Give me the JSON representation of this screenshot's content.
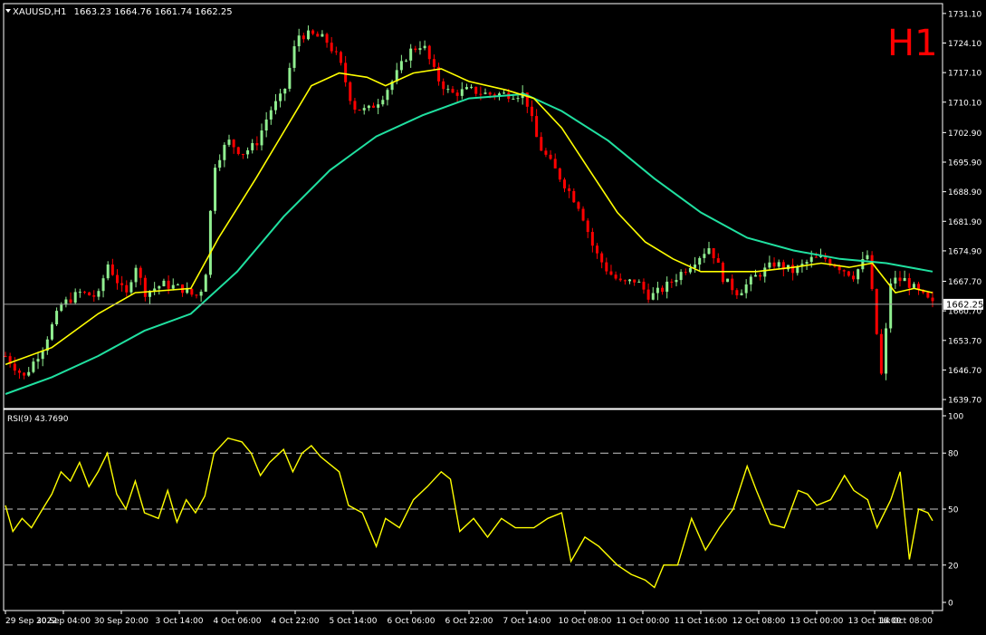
{
  "header": {
    "symbol_label": "XAUUSD,H1",
    "ohlc": "1663.23 1664.76 1661.74 1662.25",
    "timeframe_badge": "H1",
    "rsi_label": "RSI(9) 43.7690"
  },
  "colors": {
    "background": "#000000",
    "axis": "#ffffff",
    "bull_candle": "#90ee90",
    "bear_candle": "#ff0000",
    "ma_fast": "#ffff00",
    "ma_slow": "#20e0a0",
    "rsi_line": "#ffff00",
    "badge": "#ff0000"
  },
  "chart_data": [
    {
      "type": "candlestick",
      "symbol": "XAUUSD",
      "timeframe": "H1",
      "current_price": 1662.25,
      "current_price_label": "1662.25",
      "ylim": [
        1638.0,
        1733.0
      ],
      "y_ticks": [
        {
          "value": 1731.1,
          "label": "1731.10"
        },
        {
          "value": 1724.1,
          "label": "1724.10"
        },
        {
          "value": 1717.1,
          "label": "1717.10"
        },
        {
          "value": 1710.1,
          "label": "1710.10"
        },
        {
          "value": 1702.9,
          "label": "1702.90"
        },
        {
          "value": 1695.9,
          "label": "1695.90"
        },
        {
          "value": 1688.9,
          "label": "1688.90"
        },
        {
          "value": 1681.9,
          "label": "1681.90"
        },
        {
          "value": 1674.9,
          "label": "1674.90"
        },
        {
          "value": 1667.7,
          "label": "1667.70"
        },
        {
          "value": 1660.7,
          "label": "1660.70"
        },
        {
          "value": 1653.7,
          "label": "1653.70"
        },
        {
          "value": 1646.7,
          "label": "1646.70"
        },
        {
          "value": 1639.7,
          "label": "1639.70"
        }
      ],
      "x_ticks": [
        {
          "label": "29 Sep 2022",
          "frac": 0.0
        },
        {
          "label": "30 Sep 04:00",
          "frac": 0.0625
        },
        {
          "label": "30 Sep 20:00",
          "frac": 0.125
        },
        {
          "label": "3 Oct 14:00",
          "frac": 0.1875
        },
        {
          "label": "4 Oct 06:00",
          "frac": 0.25
        },
        {
          "label": "4 Oct 22:00",
          "frac": 0.3125
        },
        {
          "label": "5 Oct 14:00",
          "frac": 0.375
        },
        {
          "label": "6 Oct 06:00",
          "frac": 0.4375
        },
        {
          "label": "6 Oct 22:00",
          "frac": 0.5
        },
        {
          "label": "7 Oct 14:00",
          "frac": 0.5625
        },
        {
          "label": "10 Oct 08:00",
          "frac": 0.625
        },
        {
          "label": "11 Oct 00:00",
          "frac": 0.6875
        },
        {
          "label": "11 Oct 16:00",
          "frac": 0.75
        },
        {
          "label": "12 Oct 08:00",
          "frac": 0.8125
        },
        {
          "label": "13 Oct 00:00",
          "frac": 0.875
        },
        {
          "label": "13 Oct 16:00",
          "frac": 0.9375
        },
        {
          "label": "14 Oct 08:00",
          "frac": 1.0
        }
      ],
      "close_path": [
        [
          0.0,
          1650
        ],
        [
          0.02,
          1645
        ],
        [
          0.04,
          1652
        ],
        [
          0.06,
          1662
        ],
        [
          0.08,
          1665
        ],
        [
          0.1,
          1664
        ],
        [
          0.11,
          1672
        ],
        [
          0.12,
          1668
        ],
        [
          0.13,
          1664
        ],
        [
          0.14,
          1672
        ],
        [
          0.15,
          1665
        ],
        [
          0.17,
          1667
        ],
        [
          0.19,
          1666
        ],
        [
          0.205,
          1664
        ],
        [
          0.215,
          1667
        ],
        [
          0.225,
          1695
        ],
        [
          0.24,
          1701
        ],
        [
          0.255,
          1698
        ],
        [
          0.27,
          1700
        ],
        [
          0.285,
          1708
        ],
        [
          0.3,
          1712
        ],
        [
          0.315,
          1726
        ],
        [
          0.33,
          1726
        ],
        [
          0.345,
          1725
        ],
        [
          0.36,
          1720
        ],
        [
          0.375,
          1709
        ],
        [
          0.39,
          1708
        ],
        [
          0.405,
          1711
        ],
        [
          0.42,
          1716
        ],
        [
          0.435,
          1722
        ],
        [
          0.45,
          1724
        ],
        [
          0.465,
          1716
        ],
        [
          0.48,
          1712
        ],
        [
          0.5,
          1713
        ],
        [
          0.52,
          1712
        ],
        [
          0.54,
          1712
        ],
        [
          0.56,
          1712
        ],
        [
          0.575,
          1700
        ],
        [
          0.59,
          1695
        ],
        [
          0.605,
          1690
        ],
        [
          0.62,
          1685
        ],
        [
          0.635,
          1675
        ],
        [
          0.65,
          1670
        ],
        [
          0.665,
          1667
        ],
        [
          0.68,
          1668
        ],
        [
          0.695,
          1664
        ],
        [
          0.71,
          1666
        ],
        [
          0.725,
          1669
        ],
        [
          0.74,
          1672
        ],
        [
          0.76,
          1676
        ],
        [
          0.775,
          1668
        ],
        [
          0.79,
          1665
        ],
        [
          0.81,
          1669
        ],
        [
          0.83,
          1672
        ],
        [
          0.85,
          1670
        ],
        [
          0.87,
          1673
        ],
        [
          0.885,
          1673
        ],
        [
          0.9,
          1671
        ],
        [
          0.915,
          1669
        ],
        [
          0.93,
          1674
        ],
        [
          0.945,
          1645
        ],
        [
          0.955,
          1668
        ],
        [
          0.97,
          1668
        ],
        [
          0.985,
          1665
        ],
        [
          1.0,
          1662.25
        ]
      ],
      "ma_fast_path": [
        [
          0.0,
          1648
        ],
        [
          0.05,
          1652
        ],
        [
          0.1,
          1660
        ],
        [
          0.14,
          1665
        ],
        [
          0.2,
          1666
        ],
        [
          0.23,
          1678
        ],
        [
          0.27,
          1692
        ],
        [
          0.3,
          1703
        ],
        [
          0.33,
          1714
        ],
        [
          0.36,
          1717
        ],
        [
          0.39,
          1716
        ],
        [
          0.41,
          1714
        ],
        [
          0.44,
          1717
        ],
        [
          0.47,
          1718
        ],
        [
          0.5,
          1715
        ],
        [
          0.54,
          1713
        ],
        [
          0.57,
          1711
        ],
        [
          0.6,
          1704
        ],
        [
          0.63,
          1694
        ],
        [
          0.66,
          1684
        ],
        [
          0.69,
          1677
        ],
        [
          0.72,
          1673
        ],
        [
          0.75,
          1670
        ],
        [
          0.78,
          1670
        ],
        [
          0.81,
          1670
        ],
        [
          0.85,
          1671
        ],
        [
          0.88,
          1672
        ],
        [
          0.91,
          1671
        ],
        [
          0.935,
          1672
        ],
        [
          0.96,
          1665
        ],
        [
          0.98,
          1666
        ],
        [
          1.0,
          1665
        ]
      ],
      "ma_slow_path": [
        [
          0.0,
          1641
        ],
        [
          0.05,
          1645
        ],
        [
          0.1,
          1650
        ],
        [
          0.15,
          1656
        ],
        [
          0.2,
          1660
        ],
        [
          0.25,
          1670
        ],
        [
          0.3,
          1683
        ],
        [
          0.35,
          1694
        ],
        [
          0.4,
          1702
        ],
        [
          0.45,
          1707
        ],
        [
          0.5,
          1711
        ],
        [
          0.56,
          1712
        ],
        [
          0.6,
          1708
        ],
        [
          0.65,
          1701
        ],
        [
          0.7,
          1692
        ],
        [
          0.75,
          1684
        ],
        [
          0.8,
          1678
        ],
        [
          0.85,
          1675
        ],
        [
          0.9,
          1673
        ],
        [
          0.95,
          1672
        ],
        [
          1.0,
          1670
        ]
      ]
    },
    {
      "type": "line",
      "name": "RSI(9)",
      "value": 43.769,
      "ylim": [
        0,
        100
      ],
      "y_ticks": [
        {
          "value": 100,
          "label": "100"
        },
        {
          "value": 80,
          "label": "80"
        },
        {
          "value": 50,
          "label": "50"
        },
        {
          "value": 20,
          "label": "20"
        },
        {
          "value": 0,
          "label": "0"
        }
      ],
      "levels": [
        80,
        50,
        20
      ],
      "path": [
        [
          0.0,
          52
        ],
        [
          0.008,
          38
        ],
        [
          0.018,
          45
        ],
        [
          0.028,
          40
        ],
        [
          0.04,
          50
        ],
        [
          0.05,
          58
        ],
        [
          0.06,
          70
        ],
        [
          0.07,
          65
        ],
        [
          0.08,
          75
        ],
        [
          0.09,
          62
        ],
        [
          0.1,
          70
        ],
        [
          0.11,
          80
        ],
        [
          0.12,
          58
        ],
        [
          0.13,
          50
        ],
        [
          0.14,
          65
        ],
        [
          0.15,
          48
        ],
        [
          0.165,
          45
        ],
        [
          0.175,
          60
        ],
        [
          0.185,
          43
        ],
        [
          0.195,
          55
        ],
        [
          0.205,
          48
        ],
        [
          0.215,
          57
        ],
        [
          0.225,
          80
        ],
        [
          0.24,
          88
        ],
        [
          0.255,
          86
        ],
        [
          0.265,
          80
        ],
        [
          0.275,
          68
        ],
        [
          0.285,
          75
        ],
        [
          0.3,
          82
        ],
        [
          0.31,
          70
        ],
        [
          0.32,
          80
        ],
        [
          0.33,
          84
        ],
        [
          0.34,
          78
        ],
        [
          0.36,
          70
        ],
        [
          0.37,
          52
        ],
        [
          0.385,
          48
        ],
        [
          0.4,
          30
        ],
        [
          0.41,
          45
        ],
        [
          0.425,
          40
        ],
        [
          0.44,
          55
        ],
        [
          0.455,
          62
        ],
        [
          0.47,
          70
        ],
        [
          0.48,
          66
        ],
        [
          0.49,
          38
        ],
        [
          0.505,
          45
        ],
        [
          0.52,
          35
        ],
        [
          0.535,
          45
        ],
        [
          0.55,
          40
        ],
        [
          0.57,
          40
        ],
        [
          0.585,
          45
        ],
        [
          0.6,
          48
        ],
        [
          0.61,
          22
        ],
        [
          0.625,
          35
        ],
        [
          0.64,
          30
        ],
        [
          0.66,
          20
        ],
        [
          0.675,
          15
        ],
        [
          0.69,
          12
        ],
        [
          0.7,
          8
        ],
        [
          0.71,
          20
        ],
        [
          0.725,
          20
        ],
        [
          0.74,
          45
        ],
        [
          0.755,
          28
        ],
        [
          0.77,
          40
        ],
        [
          0.785,
          50
        ],
        [
          0.8,
          73
        ],
        [
          0.81,
          60
        ],
        [
          0.825,
          42
        ],
        [
          0.84,
          40
        ],
        [
          0.855,
          60
        ],
        [
          0.865,
          58
        ],
        [
          0.875,
          52
        ],
        [
          0.89,
          55
        ],
        [
          0.905,
          68
        ],
        [
          0.915,
          60
        ],
        [
          0.93,
          55
        ],
        [
          0.94,
          40
        ],
        [
          0.955,
          55
        ],
        [
          0.965,
          70
        ],
        [
          0.975,
          23
        ],
        [
          0.985,
          50
        ],
        [
          0.995,
          48
        ],
        [
          1.0,
          43.769
        ]
      ]
    }
  ]
}
